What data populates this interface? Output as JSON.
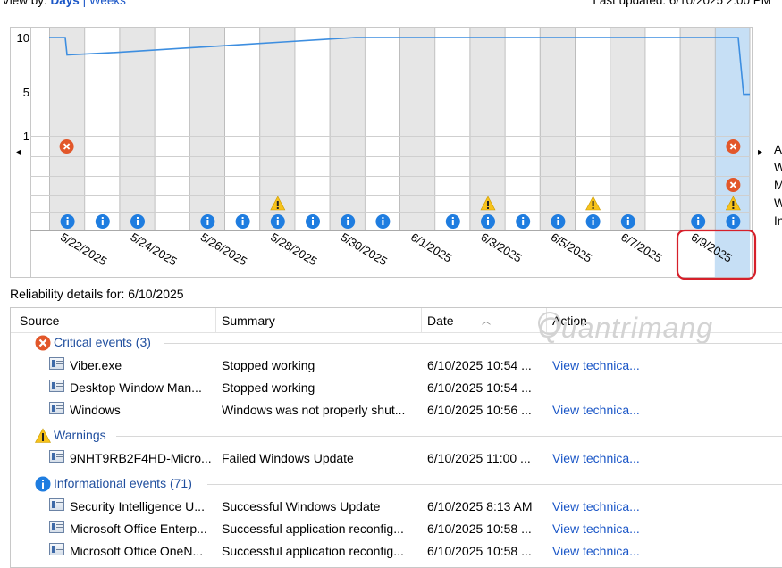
{
  "header": {
    "view_by_label": "View by:",
    "days_link": "Days",
    "separator": "|",
    "weeks_link": "Weeks",
    "last_updated": "Last updated: 6/10/2025 2:00 PM"
  },
  "chart": {
    "y_ticks": [
      "10",
      "5",
      "1"
    ],
    "x_labels": [
      "5/22/2025",
      "5/24/2025",
      "5/26/2025",
      "5/28/2025",
      "5/30/2025",
      "6/1/2025",
      "6/3/2025",
      "6/5/2025",
      "6/7/2025",
      "6/9/2025"
    ],
    "prev_arrow": "◂",
    "next_arrow": "▸",
    "right_row_labels": [
      "A",
      "W",
      "M",
      "W",
      "In"
    ],
    "stability_index": [
      10,
      8.4,
      8.6,
      8.8,
      9.0,
      9.2,
      9.4,
      9.6,
      9.8,
      10,
      10,
      10,
      10,
      10,
      10,
      10,
      10,
      10,
      10,
      10,
      4.8
    ],
    "critical_days": [
      0,
      19
    ],
    "application_failure_days": [
      19
    ],
    "warning_days": [
      6,
      12,
      15,
      19
    ],
    "info_days": [
      0,
      1,
      2,
      4,
      5,
      6,
      7,
      8,
      9,
      11,
      12,
      13,
      14,
      15,
      16,
      18,
      19
    ],
    "selected_day": 19,
    "highlighted_label": "6/9/2025",
    "colors": {
      "line": "#3d8ee0",
      "selected": "#c6dff5",
      "highlight_box": "#d6202a",
      "critical": "#e2572a",
      "warning": "#f7c21b",
      "info": "#1f7de0"
    }
  },
  "details": {
    "title": "Reliability details for: 6/10/2025",
    "columns": [
      "Source",
      "Summary",
      "Date",
      "Action"
    ],
    "watermark": "Quantrimang",
    "groups": [
      {
        "label": "Critical events (3)",
        "icon": "critical-icon",
        "rows": [
          {
            "source": "Viber.exe",
            "summary": "Stopped working",
            "date": "6/10/2025 10:54 ...",
            "action": "View technica..."
          },
          {
            "source": "Desktop Window Man...",
            "summary": "Stopped working",
            "date": "6/10/2025 10:54 ...",
            "action": ""
          },
          {
            "source": "Windows",
            "summary": "Windows was not properly shut...",
            "date": "6/10/2025 10:56 ...",
            "action": "View technica..."
          }
        ]
      },
      {
        "label": "Warnings",
        "icon": "warning-icon",
        "rows": [
          {
            "source": "9NHT9RB2F4HD-Micro...",
            "summary": "Failed Windows Update",
            "date": "6/10/2025 11:00 ...",
            "action": "View technica..."
          }
        ]
      },
      {
        "label": "Informational events (71)",
        "icon": "info-icon",
        "rows": [
          {
            "source": "Security Intelligence U...",
            "summary": "Successful Windows Update",
            "date": "6/10/2025 8:13 AM",
            "action": "View technica..."
          },
          {
            "source": "Microsoft Office Enterp...",
            "summary": "Successful application reconfig...",
            "date": "6/10/2025 10:58 ...",
            "action": "View technica..."
          },
          {
            "source": "Microsoft Office OneN...",
            "summary": "Successful application reconfig...",
            "date": "6/10/2025 10:58 ...",
            "action": "View technica..."
          }
        ]
      }
    ]
  }
}
